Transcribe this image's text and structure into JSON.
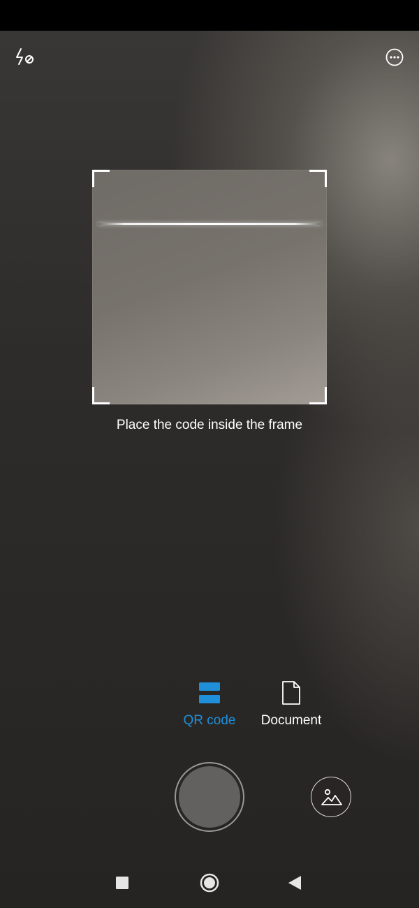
{
  "scanner": {
    "hint": "Place the code inside the frame"
  },
  "modes": [
    {
      "label": "QR code",
      "icon": "qr-code-icon",
      "active": true
    },
    {
      "label": "Document",
      "icon": "document-icon",
      "active": false
    }
  ],
  "top_bar": {
    "flash_icon": "flash-off-icon",
    "menu_icon": "more-options-icon"
  },
  "controls": {
    "shutter_icon": "shutter-button",
    "gallery_icon": "image-gallery-icon"
  },
  "nav_bar": {
    "icons": [
      "recents-square-icon",
      "home-circle-icon",
      "back-triangle-icon"
    ]
  },
  "colors": {
    "accent": "#1e8fd8",
    "text": "#ffffff",
    "status_bar": "#000000"
  }
}
